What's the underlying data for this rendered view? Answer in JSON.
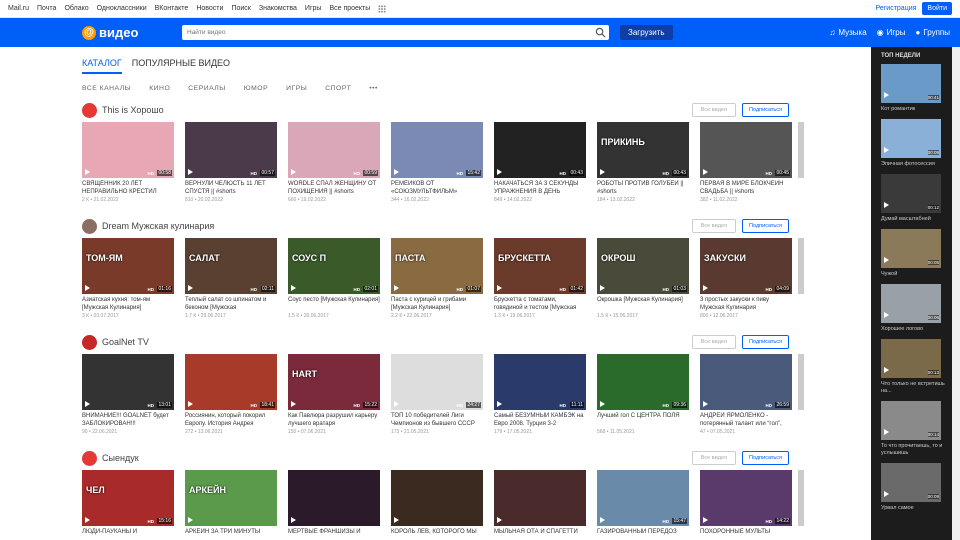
{
  "portal": {
    "nav": [
      "Mail.ru",
      "Почта",
      "Облако",
      "Одноклассники",
      "ВКонтакте",
      "Новости",
      "Поиск",
      "Знакомства",
      "Игры",
      "Все проекты"
    ],
    "register": "Регистрация",
    "login": "Войти"
  },
  "header": {
    "logo": "видео",
    "search_placeholder": "Найти видео",
    "upload": "Загрузить",
    "links": [
      "Музыка",
      "Игры",
      "Группы"
    ]
  },
  "tabs": [
    "КАТАЛОГ",
    "ПОПУЛЯРНЫЕ ВИДЕО"
  ],
  "subtabs": [
    "ВСЕ КАНАЛЫ",
    "КИНО",
    "СЕРИАЛЫ",
    "ЮМОР",
    "ИГРЫ",
    "СПОРТ",
    "•••"
  ],
  "buttons": {
    "all": "Все видео",
    "subscribe": "Подписаться"
  },
  "sections": [
    {
      "name": "This is Хорошо",
      "icon_color": "#e53935",
      "videos": [
        {
          "title": "СВЯЩЕННИК 20 ЛЕТ НЕПРАВИЛЬНО КРЕСТИЛ",
          "meta": "2 К • 21.02.2022",
          "dur": "00:58",
          "color": "#e8a7b5"
        },
        {
          "title": "ВЕРНУЛИ ЧЕЛЮСТЬ 11 ЛЕТ СПУСТЯ || #shorts",
          "meta": "810 • 20.02.2022",
          "dur": "00:57",
          "color": "#4a3a4a"
        },
        {
          "title": "WORDLE СПАЛ ЖЕНЩИНУ ОТ ПОХИЩЕНИЯ || #shorts",
          "meta": "666 • 19.02.2022",
          "dur": "00:59",
          "color": "#d9a7b8"
        },
        {
          "title": "РЕМЕЙКОВ ОТ «СОЮЗМУЛЬТФИЛЬМ»",
          "meta": "344 • 16.02.2022",
          "dur": "15:42",
          "color": "#7a8ab5"
        },
        {
          "title": "НАКАЧАТЬСЯ ЗА 3 СЕКУНДЫ УПРАЖНЕНИЯ В ДЕНЬ",
          "meta": "849 • 14.02.2022",
          "dur": "00:43",
          "color": "#222"
        },
        {
          "title": "РОБОТЫ ПРОТИВ ГОЛУБЕЙ || #shorts",
          "meta": "184 • 13.02.2022",
          "dur": "00:43",
          "color": "#333",
          "cap": "ПРИКИНЬ"
        },
        {
          "title": "ПЕРВАЯ В МИРЕ БЛОКЧЕЙН СВАДЬБА || #shorts",
          "meta": "382 • 11.02.2022",
          "dur": "00:45",
          "color": "#555"
        }
      ]
    },
    {
      "name": "Dream Мужская кулинария",
      "icon_color": "#8d6e63",
      "videos": [
        {
          "title": "Азиатская кухня: том-ям [Мужская Кулинария]",
          "meta": "3 К • 03.07.2017",
          "dur": "01:16",
          "color": "#7a3a2a",
          "cap": "ТОМ-ЯМ"
        },
        {
          "title": "Теплый салат со шпинатом и беконом [Мужская",
          "meta": "1.7 К • 29.06.2017",
          "dur": "02:11",
          "color": "#5a4030",
          "cap": "САЛАТ"
        },
        {
          "title": "Соус песто [Мужская Кулинария]",
          "meta": "1.5 К • 26.06.2017",
          "dur": "02:01",
          "color": "#3a5a2a",
          "cap": "СОУС П"
        },
        {
          "title": "Паста с курицей и грибами [Мужская Кулинария]",
          "meta": "2.2 К • 22.06.2017",
          "dur": "01:07",
          "color": "#8a6a40",
          "cap": "ПАСТА"
        },
        {
          "title": "Брускетта с томатами, говядиной и тестом [Мужская",
          "meta": "1.3 К • 19.06.2017",
          "dur": "01:42",
          "color": "#6a3a2a",
          "cap": "БРУСКЕТТА"
        },
        {
          "title": "Окрошка [Мужская Кулинария]",
          "meta": "1.5 К • 15.06.2017",
          "dur": "01:03",
          "color": "#4a4a3a",
          "cap": "ОКРОШ"
        },
        {
          "title": "3 простых закуски к пиву Мужская Кулинария",
          "meta": "800 • 12.06.2017",
          "dur": "04:09",
          "color": "#5a3a30",
          "cap": "ЗАКУСКИ"
        }
      ]
    },
    {
      "name": "GoalNet TV",
      "icon_color": "#c62828",
      "videos": [
        {
          "title": "ВНИМАНИЕ!!! GOALNET будет ЗАБЛОКИРОВАН!!!",
          "meta": "90 • 22.06.2021",
          "dur": "13:01",
          "color": "#333"
        },
        {
          "title": "Россиянин, который покорил Европу. История Андрея",
          "meta": "272 • 13.06.2021",
          "dur": "18:41",
          "color": "#a83a2a"
        },
        {
          "title": "Как Павлюра разрушил карьеру лучшего вратаря",
          "meta": "150 • 07.06.2021",
          "dur": "15:22",
          "color": "#7a2a3a",
          "cap": "HART"
        },
        {
          "title": "ТОП 10 победителей Лиги Чемпионов из бывшего СССР",
          "meta": "173 • 21.05.2021",
          "dur": "24:27",
          "color": "#ddd"
        },
        {
          "title": "Самый БЕЗУМНЫЙ КАМБЭК на Евро 2008. Турция 3-2",
          "meta": "179 • 17.05.2021",
          "dur": "11:11",
          "color": "#2a3a6a"
        },
        {
          "title": "Лучший гол С ЦЕНТРА ПОЛЯ",
          "meta": "568 • 11.05.2021",
          "dur": "09:36",
          "color": "#2a6a2a"
        },
        {
          "title": "АНДРЕЙ ЯРМОЛЕНКО - потерянный талант или “гол”,",
          "meta": "47 • 07.05.2021",
          "dur": "26:59",
          "color": "#4a5a7a"
        }
      ]
    },
    {
      "name": "Сыендук",
      "icon_color": "#e53935",
      "videos": [
        {
          "title": "ЛЮДИ-ПАУКАНЫ И",
          "meta": "",
          "dur": "15:16",
          "color": "#a82a2a",
          "cap": "ЧЕЛ"
        },
        {
          "title": "АРКЕЙН ЗА ТРИ МИНУТЫ",
          "meta": "",
          "dur": "",
          "color": "#5a9a4a",
          "cap": "АРКЕЙН"
        },
        {
          "title": "МЁРТВЫЕ ФРАНШИЗЫ И",
          "meta": "",
          "dur": "",
          "color": "#2a1a2a"
        },
        {
          "title": "КОРОЛЬ ЛЕВ, КОТОРОГО МЫ",
          "meta": "",
          "dur": "",
          "color": "#3a2a20"
        },
        {
          "title": "МЫЛЬНАЯ ОТА И СПАГЕТТИ",
          "meta": "",
          "dur": "",
          "color": "#4a2a2a"
        },
        {
          "title": "ГАЗИРОВАННЫЙ ПЕРЕДОЗ",
          "meta": "",
          "dur": "15:47",
          "color": "#6a8aaa"
        },
        {
          "title": "ПОХОРОННЫЕ МУЛЬТЫ",
          "meta": "",
          "dur": "14:22",
          "color": "#5a3a6a"
        }
      ]
    }
  ],
  "sidebar": {
    "title": "ТОП НЕДЕЛИ",
    "items": [
      {
        "title": "Кот романтик",
        "dur": "00:41",
        "color": "#6a9ac8"
      },
      {
        "title": "Эпичная фотосессия",
        "dur": "00:09",
        "color": "#8ab0d8"
      },
      {
        "title": "Думай масштабней",
        "dur": "00:12",
        "color": "#3a3a3a"
      },
      {
        "title": "Чужой",
        "dur": "00:05",
        "color": "#8a7a5a"
      },
      {
        "title": "Хорошее логово",
        "dur": "00:06",
        "color": "#9aa0a8"
      },
      {
        "title": "Что только не встретишь на...",
        "dur": "00:13",
        "color": "#7a6a4a"
      },
      {
        "title": "То что прочитаешь, то и услышишь",
        "dur": "00:14",
        "color": "#8a8a8a"
      },
      {
        "title": "Урвал самое",
        "dur": "00:09",
        "color": "#6a6a6a"
      }
    ]
  }
}
